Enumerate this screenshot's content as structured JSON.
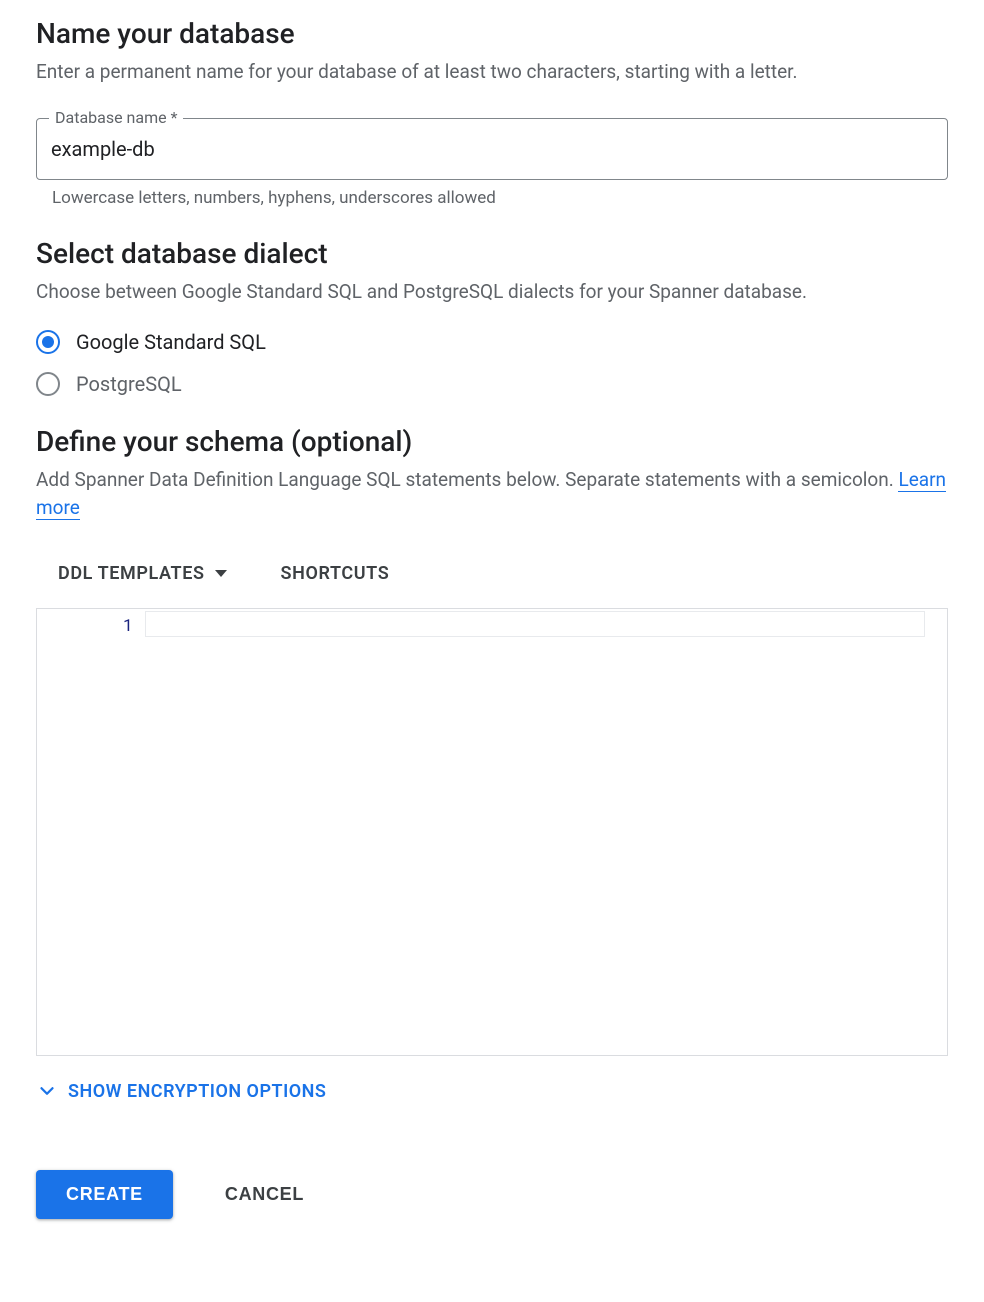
{
  "name_section": {
    "heading": "Name your database",
    "description": "Enter a permanent name for your database of at least two characters, starting with a letter.",
    "field_label": "Database name *",
    "field_value": "example-db",
    "helper_text": "Lowercase letters, numbers, hyphens, underscores allowed"
  },
  "dialect_section": {
    "heading": "Select database dialect",
    "description": "Choose between Google Standard SQL and PostgreSQL dialects for your Spanner database.",
    "options": [
      {
        "label": "Google Standard SQL",
        "selected": true
      },
      {
        "label": "PostgreSQL",
        "selected": false
      }
    ]
  },
  "schema_section": {
    "heading": "Define your schema (optional)",
    "description_pre": "Add Spanner Data Definition Language SQL statements below. Separate statements with a semicolon. ",
    "learn_more": "Learn more",
    "toolbar": {
      "ddl_templates": "DDL TEMPLATES",
      "shortcuts": "SHORTCUTS"
    },
    "editor": {
      "line_number": "1",
      "content": ""
    }
  },
  "encryption_expander": "SHOW ENCRYPTION OPTIONS",
  "actions": {
    "create": "CREATE",
    "cancel": "CANCEL"
  }
}
